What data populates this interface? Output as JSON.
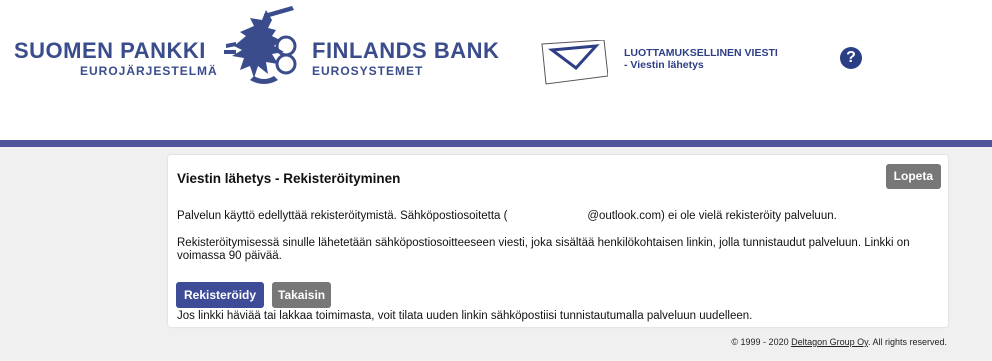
{
  "header": {
    "logo_left_big": "SUOMEN PANKKI",
    "logo_left_small": "EUROJÄRJESTELMÄ",
    "logo_right_big": "FINLANDS BANK",
    "logo_right_small": "EUROSYSTEMET",
    "secure_title_line1": "LUOTTAMUKSELLINEN VIESTI",
    "secure_title_line2": "- Viestin lähetys",
    "help_label": "?"
  },
  "colors": {
    "brand_blue": "#3a4c8c",
    "bar": "#50549a",
    "primary_button": "#3e4b96",
    "secondary_button": "#777777"
  },
  "card": {
    "title": "Viestin lähetys - Rekisteröityminen",
    "logout_label": "Lopeta",
    "p1": "Palvelun käyttö edellyttää rekisteröitymistä. Sähköpostiosoitetta (                         @outlook.com) ei ole vielä rekisteröity palveluun.",
    "p2": "Rekisteröitymisessä sinulle lähetetään sähköpostiosoitteeseen viesti, joka sisältää henkilökohtaisen linkin, jolla tunnistaudut palveluun. Linkki on voimassa 90 päivää.",
    "register_label": "Rekisteröidy",
    "back_label": "Takaisin",
    "p3": "Jos linkki häviää tai lakkaa toimimasta, voit tilata uuden linkin sähköpostiisi tunnistautumalla palveluun uudelleen."
  },
  "footer": {
    "prefix": "© 1999 - 2020 ",
    "link": "Deltagon Group Oy",
    "suffix": ". All rights reserved."
  },
  "icons": {
    "lion": "lion-emblem-icon",
    "envelope": "envelope-icon",
    "help": "question-icon"
  }
}
